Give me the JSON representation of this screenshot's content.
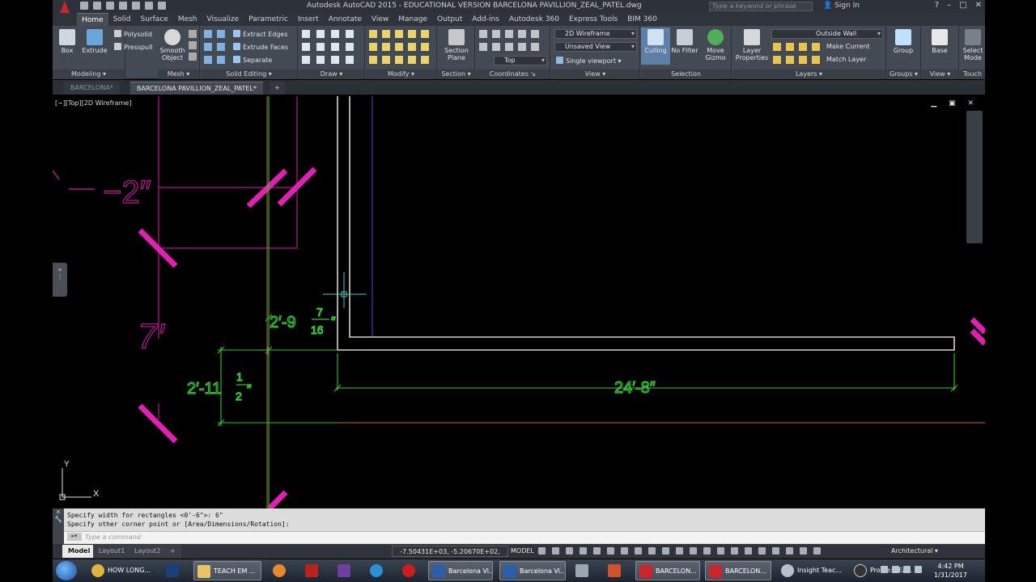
{
  "titlebar": {
    "title": "Autodesk AutoCAD 2015 - EDUCATIONAL VERSION    BARCELONA PAVILLION_ZEAL_PATEL.dwg",
    "search_placeholder": "Type a keyword or phrase",
    "signin": "Sign In"
  },
  "ribbon_tabs": [
    "Home",
    "Solid",
    "Surface",
    "Mesh",
    "Visualize",
    "Parametric",
    "Insert",
    "Annotate",
    "View",
    "Manage",
    "Output",
    "Add-ins",
    "Autodesk 360",
    "Express Tools",
    "BIM 360"
  ],
  "panels": {
    "modeling": {
      "title": "Modeling",
      "box": "Box",
      "extrude": "Extrude",
      "polysolid": "Polysolid",
      "presspull": "Presspull"
    },
    "mesh": {
      "title": "Mesh",
      "smooth": "Smooth Object"
    },
    "solid_editing": {
      "title": "Solid Editing",
      "extract_edges": "Extract Edges",
      "extrude_faces": "Extrude Faces",
      "separate": "Separate"
    },
    "draw": {
      "title": "Draw"
    },
    "modify": {
      "title": "Modify"
    },
    "section": {
      "title": "Section",
      "section_plane": "Section Plane"
    },
    "coordinates": {
      "title": "Coordinates",
      "ucs_top": "Top"
    },
    "view": {
      "title": "View",
      "visual_style": "2D Wireframe",
      "saved_view": "Unsaved View",
      "viewport": "Single viewport"
    },
    "selection": {
      "title": "Selection",
      "culling": "Culling",
      "no_filter": "No Filter",
      "move_gizmo": "Move Gizmo"
    },
    "layers": {
      "title": "Layers",
      "layer_properties": "Layer Properties",
      "current_layer": "Outside Wall",
      "make_current": "Make Current",
      "match_layer": "Match Layer"
    },
    "groups": {
      "title": "Groups",
      "group": "Group"
    },
    "view2": {
      "title": "View",
      "base": "Base"
    },
    "touch": {
      "title": "Touch",
      "select_mode": "Select Mode"
    }
  },
  "file_tabs": [
    "BARCELONA*",
    "BARCELONA PAVILLION_ZEAL_PATEL*",
    "+"
  ],
  "viewport": {
    "label": "[−][Top][2D Wireframe]",
    "controls": "▁ ▣ ✕",
    "dimensions": {
      "top_left": "−2″",
      "left_mid": "7′",
      "vertical": "2′-9",
      "vertical_frac_top": "7",
      "vertical_frac_bottom": "16",
      "vertical_suffix": "″",
      "lower": "2′-11",
      "lower_frac_top": "1",
      "lower_frac_bottom": "2",
      "lower_suffix": "″",
      "horizontal": "24′-8″"
    },
    "ucs": {
      "x": "X",
      "y": "Y"
    },
    "colors": {
      "magenta": "#e020b0",
      "green": "#39c23a",
      "wall": "#d8d5c0",
      "blue": "#3a52c6",
      "orange": "#b96f2c"
    }
  },
  "command": {
    "line1": "Specify width for rectangles <0'-6\">: 6\"",
    "line2": "Specify other corner point or [Area/Dimensions/Rotation]:",
    "placeholder": "Type a command"
  },
  "status": {
    "layout_tabs": [
      "Model",
      "Layout1",
      "Layout2",
      "+"
    ],
    "coords": "-7.50431E+03, -5.20670E+02, 0'-0\"",
    "model": "MODEL",
    "units": "Architectural"
  },
  "taskbar": {
    "items": [
      "HOW LONG...",
      "",
      "TEACH EM ...",
      "",
      "",
      "",
      "",
      "",
      "Barcelona Vi...",
      "Barcelona Vi...",
      "",
      "",
      "BARCELON...",
      "BARCELON...",
      "Insight Teac...",
      "Profile: TEA..."
    ],
    "time": "4:42 PM",
    "date": "1/31/2017"
  }
}
